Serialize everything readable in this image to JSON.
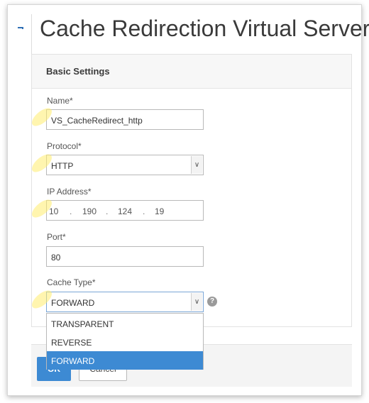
{
  "header": {
    "title": "Cache Redirection Virtual Server"
  },
  "section": {
    "title": "Basic Settings"
  },
  "form": {
    "name_label": "Name*",
    "name_value": "VS_CacheRedirect_http",
    "protocol_label": "Protocol*",
    "protocol_value": "HTTP",
    "ip_label": "IP Address*",
    "ip_octets": [
      "10",
      "190",
      "124",
      "19"
    ],
    "port_label": "Port*",
    "port_value": "80",
    "cache_type_label": "Cache Type*",
    "cache_type_value": "FORWARD",
    "cache_type_options": [
      "TRANSPARENT",
      "REVERSE",
      "FORWARD"
    ],
    "cache_type_selected_index": 2
  },
  "footer": {
    "ok_label": "OK",
    "cancel_label": "Cancel"
  },
  "colors": {
    "accent": "#3d8ad3",
    "highlight": "#ffec6e"
  },
  "icons": [
    "back-arrow-icon",
    "chevron-down-icon",
    "help-icon"
  ]
}
